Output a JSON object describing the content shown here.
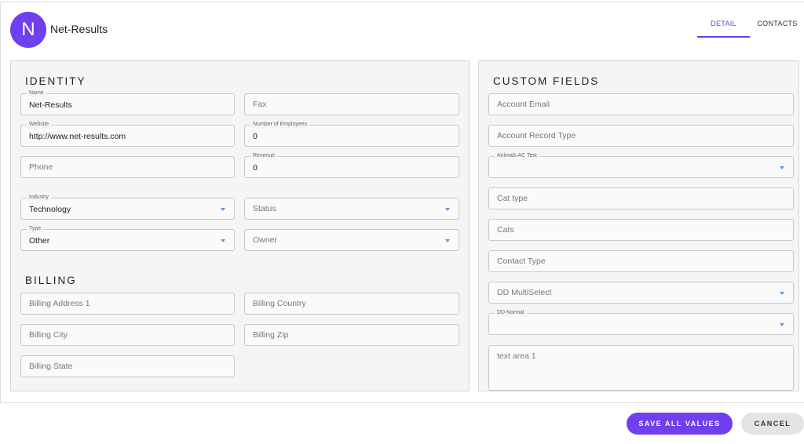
{
  "header": {
    "avatar_letter": "N",
    "company_name": "Net-Results",
    "tabs": [
      {
        "label": "DETAIL",
        "active": true
      },
      {
        "label": "CONTACTS",
        "active": false
      }
    ]
  },
  "identity": {
    "title": "IDENTITY",
    "name": {
      "label": "Name",
      "value": "Net-Results"
    },
    "fax": {
      "placeholder": "Fax"
    },
    "website": {
      "label": "Website",
      "value": "http://www.net-results.com"
    },
    "employees": {
      "label": "Number of Employees",
      "value": "0"
    },
    "phone": {
      "placeholder": "Phone"
    },
    "revenue": {
      "label": "Revenue",
      "value": "0"
    },
    "industry": {
      "label": "Industry",
      "value": "Technology"
    },
    "status": {
      "placeholder": "Status"
    },
    "type": {
      "label": "Type",
      "value": "Other"
    },
    "owner": {
      "placeholder": "Owner"
    }
  },
  "billing": {
    "title": "BILLING",
    "address1": {
      "placeholder": "Billing Address 1"
    },
    "country": {
      "placeholder": "Billing Country"
    },
    "city": {
      "placeholder": "Billing City"
    },
    "zip": {
      "placeholder": "Billing Zip"
    },
    "state": {
      "placeholder": "Billing State"
    }
  },
  "custom": {
    "title": "CUSTOM FIELDS",
    "account_email": {
      "placeholder": "Account Email"
    },
    "account_record_type": {
      "placeholder": "Account Record Type"
    },
    "animals_ac_test": {
      "label": "Animals AC Test",
      "value": ""
    },
    "cat_type": {
      "placeholder": "Cat type"
    },
    "cats": {
      "placeholder": "Cats"
    },
    "contact_type": {
      "placeholder": "Contact Type"
    },
    "dd_multiselect": {
      "placeholder": "DD MultiSelect"
    },
    "dd_normal": {
      "label": "DD Normal",
      "value": ""
    },
    "text_area": {
      "placeholder": "text area 1"
    }
  },
  "actions": {
    "save_label": "SAVE ALL VALUES",
    "cancel_label": "CANCEL"
  },
  "colors": {
    "accent": "#6f3ff0",
    "dropdown_arrow": "#5a9be6",
    "panel_bg": "#f5f5f5"
  }
}
